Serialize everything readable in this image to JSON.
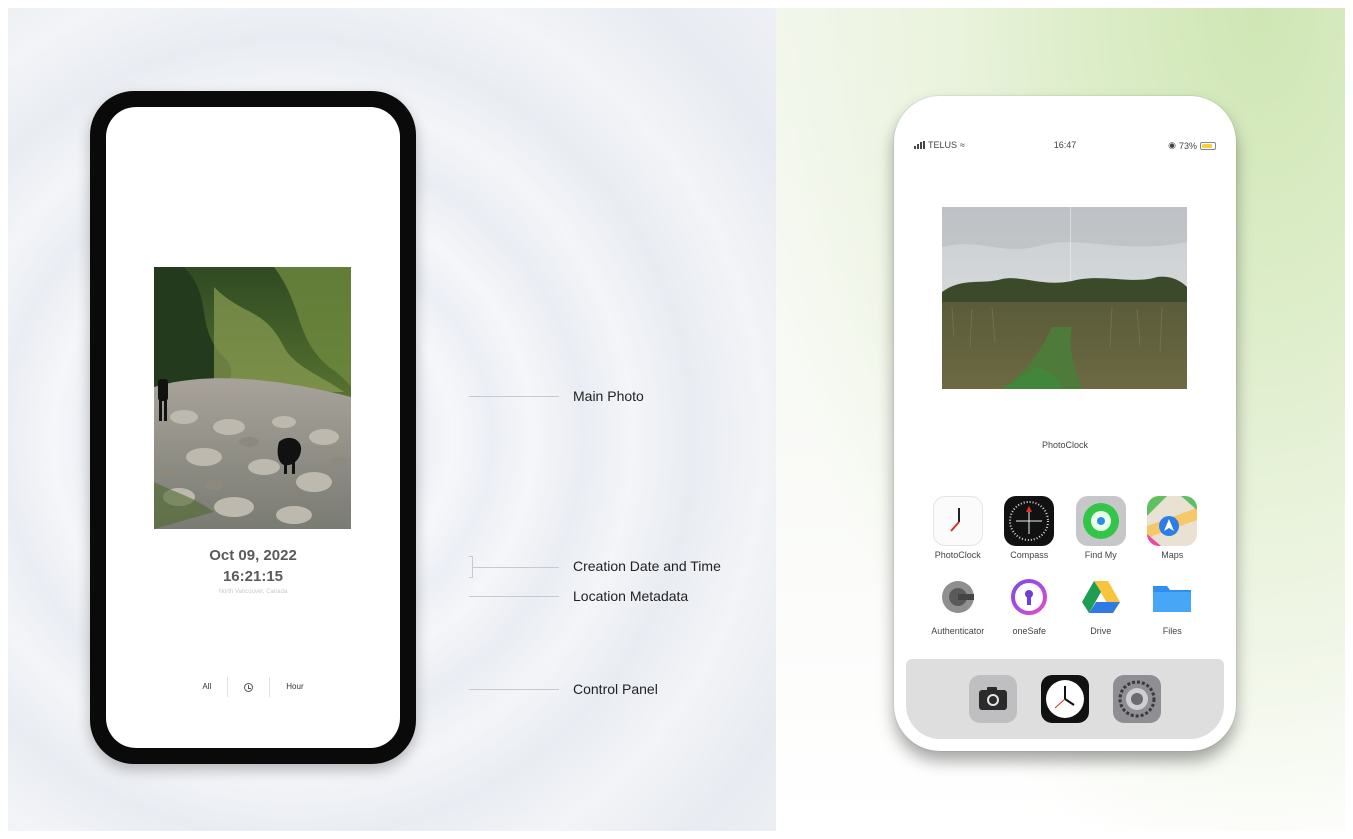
{
  "left": {
    "photo": {
      "description_icon": "rocky-creek-photo-icon"
    },
    "date": "Oct 09, 2022",
    "time": "16:21:15",
    "location": "North Vancouver, Canada",
    "controls": {
      "all_label": "All",
      "hour_label": "Hour",
      "clock_icon": "clock-icon"
    }
  },
  "annotations": {
    "main_photo": "Main Photo",
    "creation_date": "Creation Date and Time",
    "location_metadata": "Location Metadata",
    "control_panel": "Control Panel"
  },
  "right": {
    "status": {
      "carrier": "TELUS",
      "time": "16:47",
      "battery": "73%"
    },
    "widget_label": "PhotoClock",
    "apps": [
      {
        "name": "PhotoClock",
        "icon": "photoclock-icon"
      },
      {
        "name": "Compass",
        "icon": "compass-icon"
      },
      {
        "name": "Find My",
        "icon": "find-my-icon"
      },
      {
        "name": "Maps",
        "icon": "maps-icon"
      },
      {
        "name": "Authenticator",
        "icon": "authenticator-icon"
      },
      {
        "name": "oneSafe",
        "icon": "onesafe-icon"
      },
      {
        "name": "Drive",
        "icon": "drive-icon"
      },
      {
        "name": "Files",
        "icon": "files-icon"
      }
    ],
    "dock": [
      {
        "icon": "camera-icon"
      },
      {
        "icon": "clock-app-icon"
      },
      {
        "icon": "settings-icon"
      }
    ]
  }
}
